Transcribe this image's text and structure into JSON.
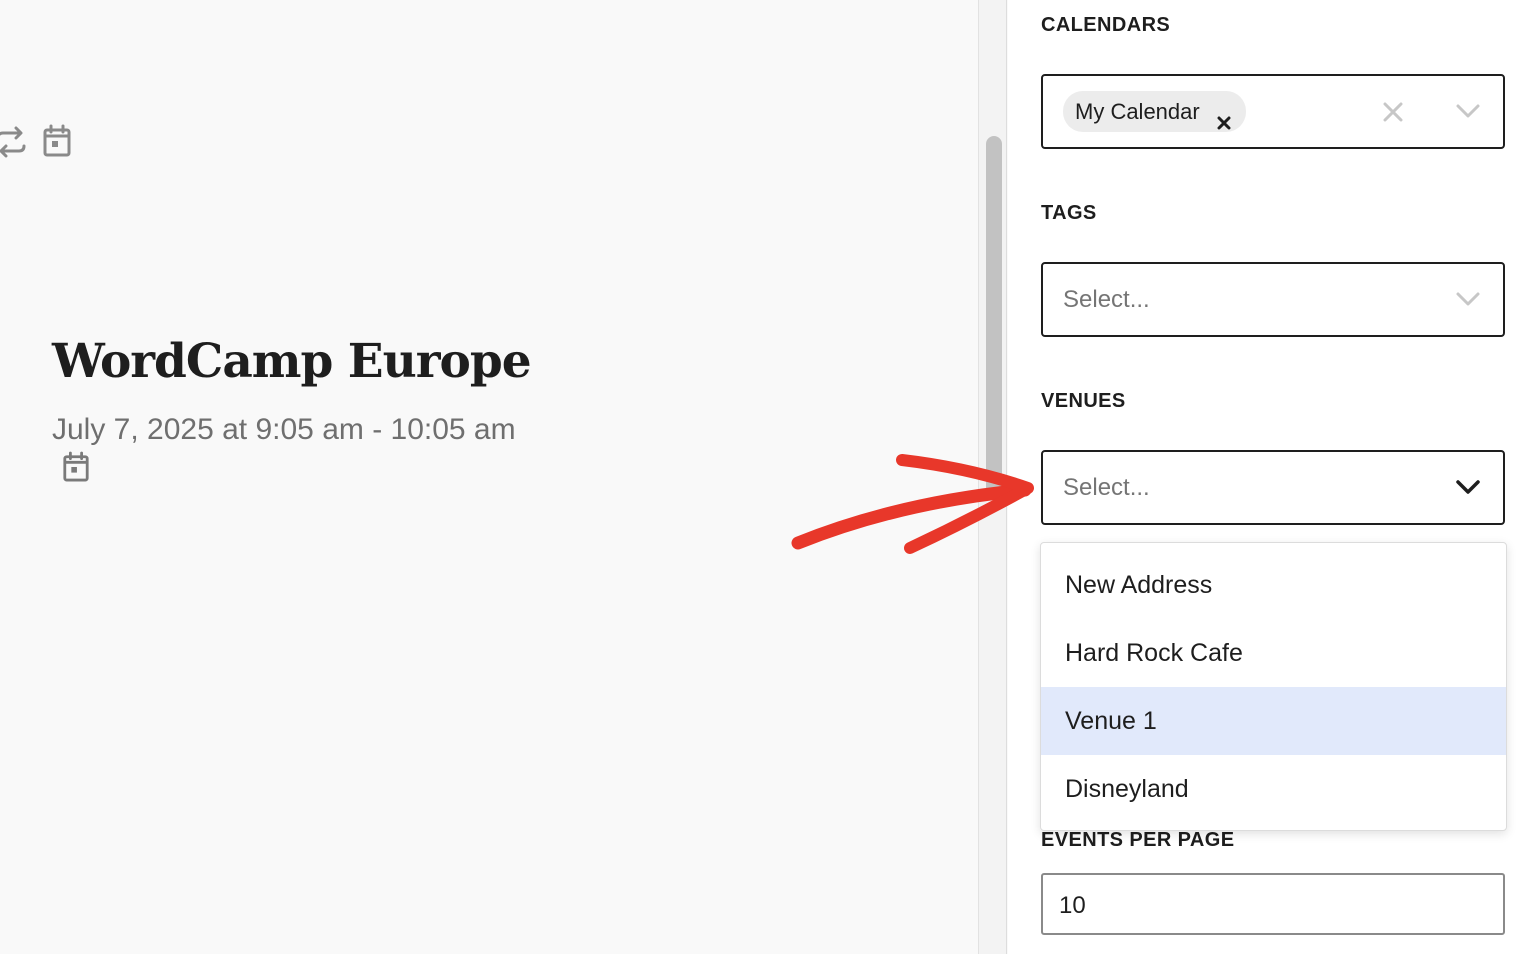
{
  "canvas": {
    "icons": [
      "repeat-icon",
      "calendar-icon"
    ],
    "event_title": "WordCamp Europe",
    "event_date": "July 7, 2025 at 9:05 am - 10:05 am"
  },
  "sidebar": {
    "calendars": {
      "label": "CALENDARS",
      "selected_token": "My Calendar"
    },
    "tags": {
      "label": "TAGS",
      "placeholder": "Select..."
    },
    "venues": {
      "label": "VENUES",
      "placeholder": "Select...",
      "options": [
        "New Address",
        "Hard Rock Cafe",
        "Venue 1",
        "Disneyland"
      ],
      "highlighted_option": "Venue 1"
    },
    "events_per_page": {
      "label": "EVENTS PER PAGE",
      "value": "10"
    }
  },
  "annotation": {
    "arrow_color": "#e8372a"
  },
  "colors": {
    "highlight": "#e1e9fb",
    "text": "#1e1e1e",
    "muted": "#757575"
  }
}
